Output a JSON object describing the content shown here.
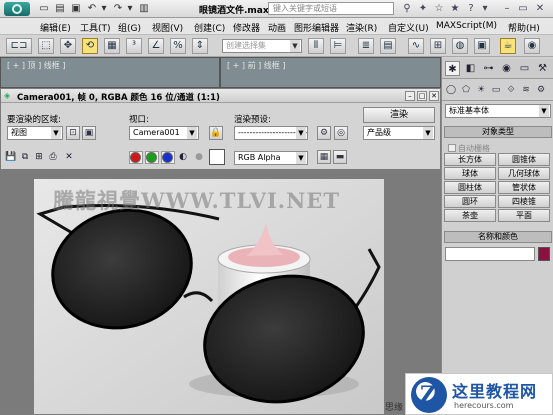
{
  "app": {
    "file_title": "眼镜酒文件.max",
    "search_placeholder": "键入关键字或短语"
  },
  "menubar": [
    "编辑(E)",
    "工具(T)",
    "组(G)",
    "视图(V)",
    "创建(C)",
    "修改器",
    "动画",
    "图形编辑器",
    "渲染(R)",
    "自定义(U)",
    "MAXScript(M)",
    "帮助(H)"
  ],
  "toolbar": {
    "selection_set_placeholder": "创建选择集"
  },
  "viewports": {
    "top_left_label": "[ + ] 顶 ] 线框 ]",
    "top_right_label": "[ + ] 前 ] 线框 ]"
  },
  "command_panel": {
    "category": "标准基本体",
    "object_type_header": "对象类型",
    "auto_grid": "自动栅格",
    "objects": [
      "长方体",
      "圆锥体",
      "球体",
      "几何球体",
      "圆柱体",
      "管状体",
      "圆环",
      "四棱锥",
      "茶壶",
      "平面"
    ],
    "name_color_header": "名称和颜色",
    "accent_color": "#8c1140"
  },
  "render_window": {
    "caption": "Camera001, 帧 0, RGBA 颜色 16 位/通道 (1:1)",
    "area_label": "要渲染的区域:",
    "area_value": "视图",
    "viewport_label": "视口:",
    "viewport_value": "Camera001",
    "preset_label": "渲染预设:",
    "preset_value": "-------------------------",
    "render_button": "渲染",
    "render_quality": "产品级",
    "channel_value": "RGB Alpha",
    "watermark": "騰龍視覺WWW.TLVI.NET",
    "corner_text": "思缘"
  },
  "badge": {
    "logo_letter": "Z",
    "name": "这里教程网",
    "url": "herecours.com"
  }
}
